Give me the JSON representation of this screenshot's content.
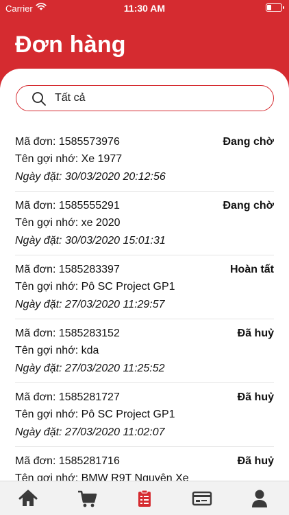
{
  "status_bar": {
    "carrier": "Carrier",
    "time": "11:30 AM"
  },
  "header": {
    "title": "Đơn hàng",
    "color": "#d52b30"
  },
  "search": {
    "value": "Tất cả",
    "icon": "search-icon"
  },
  "orders": [
    {
      "code": "Mã đơn: 1585573976",
      "nickname": "Tên gợi nhớ: Xe 1977",
      "date": "Ngày đặt: 30/03/2020 20:12:56",
      "status": "Đang chờ"
    },
    {
      "code": "Mã đơn: 1585555291",
      "nickname": "Tên gợi nhớ: xe 2020",
      "date": "Ngày đặt: 30/03/2020 15:01:31",
      "status": "Đang chờ"
    },
    {
      "code": "Mã đơn: 1585283397",
      "nickname": "Tên gợi nhớ: Pô SC Project GP1",
      "date": "Ngày đặt: 27/03/2020 11:29:57",
      "status": "Hoàn tất"
    },
    {
      "code": "Mã đơn: 1585283152",
      "nickname": "Tên gợi nhớ: kda",
      "date": "Ngày đặt: 27/03/2020 11:25:52",
      "status": "Đã huỷ"
    },
    {
      "code": "Mã đơn: 1585281727",
      "nickname": "Tên gợi nhớ: Pô SC Project GP1",
      "date": "Ngày đặt: 27/03/2020 11:02:07",
      "status": "Đã huỷ"
    },
    {
      "code": "Mã đơn: 1585281716",
      "nickname": "Tên gợi nhớ: BMW R9T Nguyên Xe",
      "date": "",
      "status": "Đã huỷ"
    }
  ],
  "tabbar": {
    "tabs": [
      {
        "icon": "home-icon",
        "active": false
      },
      {
        "icon": "cart-icon",
        "active": false
      },
      {
        "icon": "orders-icon",
        "active": true
      },
      {
        "icon": "card-icon",
        "active": false
      },
      {
        "icon": "user-icon",
        "active": false
      }
    ],
    "active_color": "#d52b30",
    "inactive_color": "#3a3a3a"
  }
}
